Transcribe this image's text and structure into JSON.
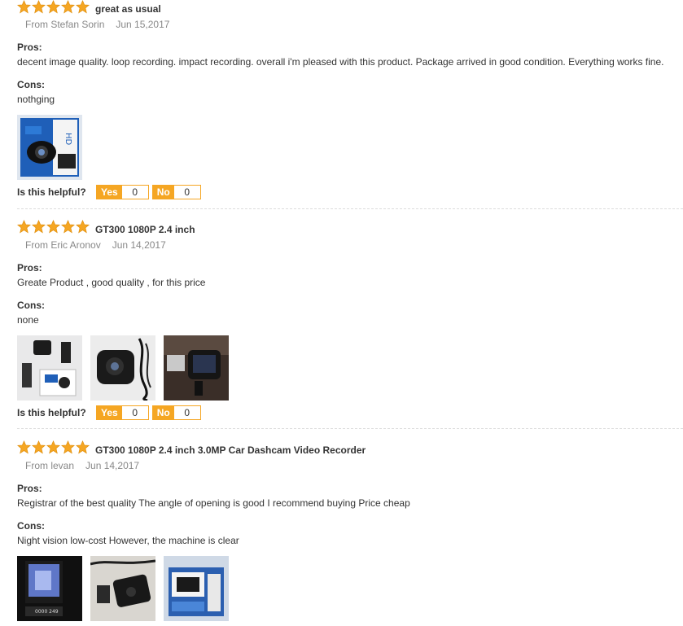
{
  "reviews": [
    {
      "rating": 5,
      "title": "great as usual",
      "author": "From Stefan Sorin",
      "date": "Jun 15,2017",
      "pros_label": "Pros:",
      "pros": "decent image quality. loop recording. impact recording. overall i'm pleased with this product. Package arrived in good condition. Everything works fine.",
      "cons_label": "Cons:",
      "cons": "nothging",
      "helpful_label": "Is this helpful?",
      "yes_label": "Yes",
      "yes_count": "0",
      "no_label": "No",
      "no_count": "0"
    },
    {
      "rating": 5,
      "title": "GT300 1080P 2.4 inch",
      "author": "From Eric Aronov",
      "date": "Jun 14,2017",
      "pros_label": "Pros:",
      "pros": "Greate Product , good quality , for this price",
      "cons_label": "Cons:",
      "cons": "none",
      "helpful_label": "Is this helpful?",
      "yes_label": "Yes",
      "yes_count": "0",
      "no_label": "No",
      "no_count": "0"
    },
    {
      "rating": 5,
      "title": "GT300 1080P 2.4 inch 3.0MP Car Dashcam Video Recorder",
      "author": "From levan",
      "date": "Jun 14,2017",
      "pros_label": "Pros:",
      "pros": "Registrar of the best quality The angle of opening is good I recommend buying Price cheap",
      "cons_label": "Cons:",
      "cons": "Night vision low-cost However, the machine is clear"
    }
  ],
  "colors": {
    "star": "#f5a623",
    "accent": "#f5a623",
    "divider": "#dcdcdc"
  }
}
